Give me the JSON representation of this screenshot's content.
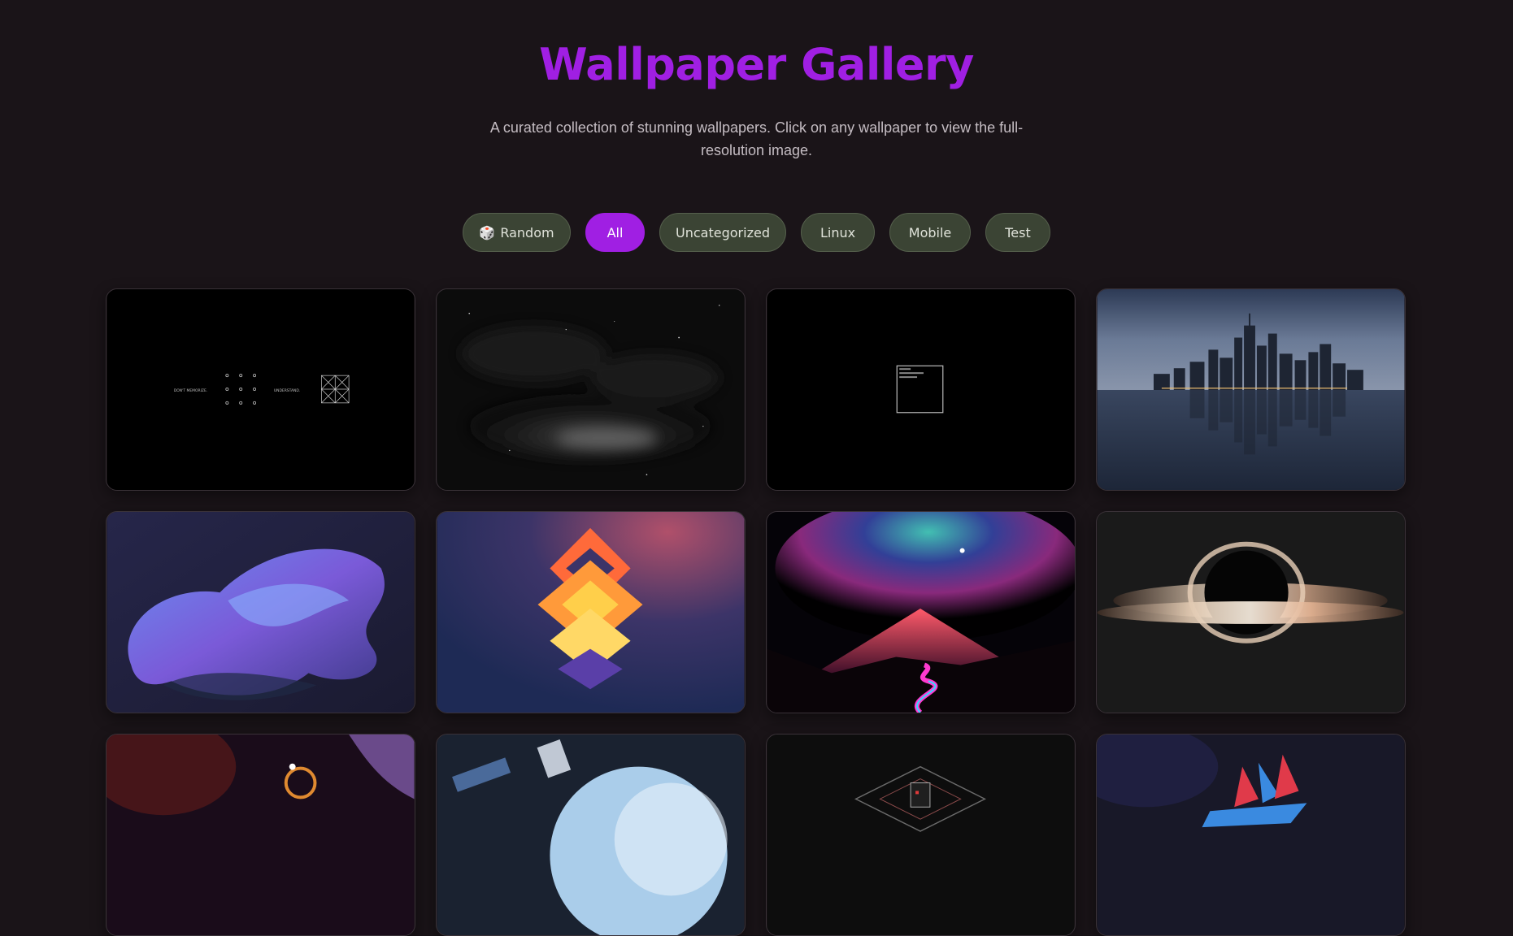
{
  "header": {
    "title": "Wallpaper Gallery",
    "subtitle": "A curated collection of stunning wallpapers. Click on any wallpaper to view the full-resolution image."
  },
  "filters": [
    {
      "label": "Random",
      "icon": "dice-icon",
      "active": false
    },
    {
      "label": "All",
      "active": true
    },
    {
      "label": "Uncategorized",
      "active": false
    },
    {
      "label": "Linux",
      "active": false
    },
    {
      "label": "Mobile",
      "active": false
    },
    {
      "label": "Test",
      "active": false
    }
  ],
  "wallpaper_1": {
    "left_text": "DON'T MEMORIZE.",
    "right_text": "UNDERSTAND."
  },
  "colors": {
    "accent": "#a01fe3",
    "background": "#1a1418",
    "chip": "#3b4434"
  }
}
